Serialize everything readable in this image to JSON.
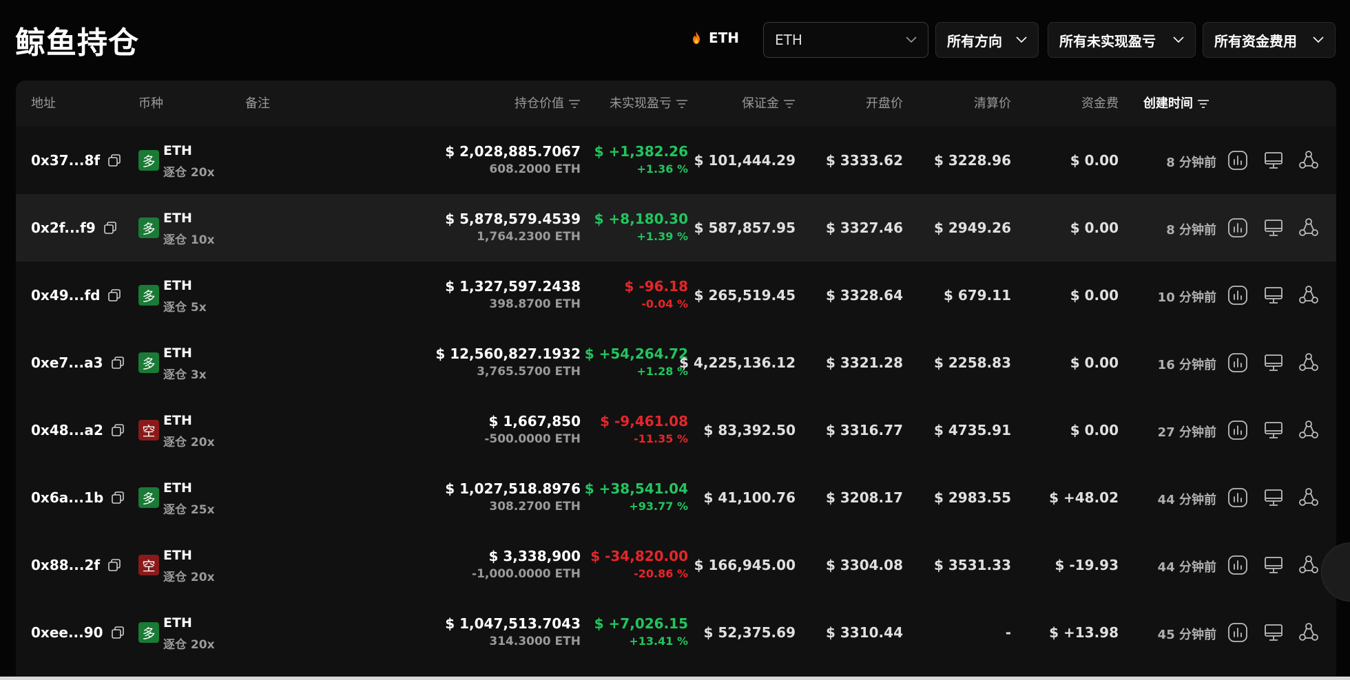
{
  "header": {
    "title": "鲸鱼持仓",
    "hot_symbol": "ETH",
    "coin_select_value": "ETH",
    "direction_filter": "所有方向",
    "pnl_filter": "所有未实现盈亏",
    "funding_filter": "所有资金费用"
  },
  "columns": {
    "address": "地址",
    "coin": "币种",
    "note": "备注",
    "position_value": "持仓价值",
    "unrealized_pnl": "未实现盈亏",
    "margin": "保证金",
    "open_price": "开盘价",
    "liq_price": "清算价",
    "funding": "资金费",
    "created": "创建时间"
  },
  "rows": [
    {
      "address": "0x37...8f",
      "side": "多",
      "side_type": "long",
      "coin": "ETH",
      "leverage": "逐仓 20x",
      "value": "$ 2,028,885.7067",
      "qty": "608.2000 ETH",
      "pnl": "$ +1,382.26",
      "pnl_pct": "+1.36 %",
      "pnl_sign": "pos",
      "margin": "$ 101,444.29",
      "open": "$ 3333.62",
      "liq": "$ 3228.96",
      "funding": "$ 0.00",
      "funding_sign": "neutral",
      "time": "8 分钟前"
    },
    {
      "address": "0x2f...f9",
      "side": "多",
      "side_type": "long",
      "coin": "ETH",
      "leverage": "逐仓 10x",
      "value": "$ 5,878,579.4539",
      "qty": "1,764.2300 ETH",
      "pnl": "$ +8,180.30",
      "pnl_pct": "+1.39 %",
      "pnl_sign": "pos",
      "margin": "$ 587,857.95",
      "open": "$ 3327.46",
      "liq": "$ 2949.26",
      "funding": "$ 0.00",
      "funding_sign": "neutral",
      "time": "8 分钟前"
    },
    {
      "address": "0x49...fd",
      "side": "多",
      "side_type": "long",
      "coin": "ETH",
      "leverage": "逐仓 5x",
      "value": "$ 1,327,597.2438",
      "qty": "398.8700 ETH",
      "pnl": "$ -96.18",
      "pnl_pct": "-0.04 %",
      "pnl_sign": "neg",
      "margin": "$ 265,519.45",
      "open": "$ 3328.64",
      "liq": "$ 679.11",
      "funding": "$ 0.00",
      "funding_sign": "neutral",
      "time": "10 分钟前"
    },
    {
      "address": "0xe7...a3",
      "side": "多",
      "side_type": "long",
      "coin": "ETH",
      "leverage": "逐仓 3x",
      "value": "$ 12,560,827.1932",
      "qty": "3,765.5700 ETH",
      "pnl": "$ +54,264.72",
      "pnl_pct": "+1.28 %",
      "pnl_sign": "pos",
      "margin": "$ 4,225,136.12",
      "open": "$ 3321.28",
      "liq": "$ 2258.83",
      "funding": "$ 0.00",
      "funding_sign": "neutral",
      "time": "16 分钟前"
    },
    {
      "address": "0x48...a2",
      "side": "空",
      "side_type": "short",
      "coin": "ETH",
      "leverage": "逐仓 20x",
      "value": "$ 1,667,850",
      "qty": "-500.0000 ETH",
      "pnl": "$ -9,461.08",
      "pnl_pct": "-11.35 %",
      "pnl_sign": "neg",
      "margin": "$ 83,392.50",
      "open": "$ 3316.77",
      "liq": "$ 4735.91",
      "funding": "$ 0.00",
      "funding_sign": "neutral",
      "time": "27 分钟前"
    },
    {
      "address": "0x6a...1b",
      "side": "多",
      "side_type": "long",
      "coin": "ETH",
      "leverage": "逐仓 25x",
      "value": "$ 1,027,518.8976",
      "qty": "308.2700 ETH",
      "pnl": "$ +38,541.04",
      "pnl_pct": "+93.77 %",
      "pnl_sign": "pos",
      "margin": "$ 41,100.76",
      "open": "$ 3208.17",
      "liq": "$ 2983.55",
      "funding": "$ +48.02",
      "funding_sign": "pos",
      "time": "44 分钟前"
    },
    {
      "address": "0x88...2f",
      "side": "空",
      "side_type": "short",
      "coin": "ETH",
      "leverage": "逐仓 20x",
      "value": "$ 3,338,900",
      "qty": "-1,000.0000 ETH",
      "pnl": "$ -34,820.00",
      "pnl_pct": "-20.86 %",
      "pnl_sign": "neg",
      "margin": "$ 166,945.00",
      "open": "$ 3304.08",
      "liq": "$ 3531.33",
      "funding": "$ -19.93",
      "funding_sign": "neg",
      "time": "44 分钟前"
    },
    {
      "address": "0xee...90",
      "side": "多",
      "side_type": "long",
      "coin": "ETH",
      "leverage": "逐仓 20x",
      "value": "$ 1,047,513.7043",
      "qty": "314.3000 ETH",
      "pnl": "$ +7,026.15",
      "pnl_pct": "+13.41 %",
      "pnl_sign": "pos",
      "margin": "$ 52,375.69",
      "open": "$ 3310.44",
      "liq": "-",
      "funding": "$ +13.98",
      "funding_sign": "pos",
      "time": "45 分钟前"
    }
  ],
  "colors": {
    "positive": "#22c55e",
    "negative": "#e5262a",
    "long_badge": "#1a7a36",
    "short_badge": "#8a1a1a",
    "background": "#050505",
    "table_bg": "#111111"
  },
  "icons": {
    "hot": "flame-icon",
    "dropdown": "chevron-down-icon",
    "sort": "filter-lines-icon",
    "copy": "copy-icon",
    "chart": "chart-icon",
    "monitor": "monitor-icon",
    "network": "network-icon"
  }
}
